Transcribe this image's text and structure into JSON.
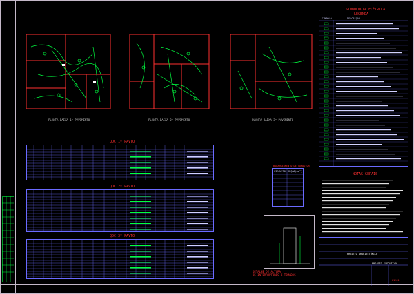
{
  "drawing": {
    "plans": [
      {
        "caption": "PLANTA BAIXA 1º PAVIMENTO"
      },
      {
        "caption": "PLANTA BAIXA 2º PAVIMENTO"
      },
      {
        "caption": "PLANTA BAIXA 3º PAVIMENTO"
      }
    ],
    "legend": {
      "title": "SIMBOLOGIA ELÉTRICA",
      "subtitle": "LEGENDA",
      "col1": "SÍMBOLO",
      "col2": "DESCRIÇÃO"
    },
    "tables": [
      {
        "title": "QDC 1º PAVTO"
      },
      {
        "title": "QDC 2º PAVTO"
      },
      {
        "title": "QDC 3º PAVTO"
      }
    ],
    "conductor_table": {
      "title": "BALANCEAMENTO DE CONDUTOR",
      "col1": "CIRCUITO",
      "col2": "SEÇÃO(mm²)"
    },
    "notes": {
      "title": "NOTAS GERAIS"
    },
    "detail_caption": "DETALHE DE ALTURA\nDE INTERRUPTORES E TOMADAS",
    "title_block": {
      "project": "PROJETO ARQUITETÔNICO",
      "phase": "PROJETO EXECUTIVO",
      "sheet": "01/01"
    },
    "colors": {
      "frame": "#c4b8c8",
      "plan_wall": "#ff3030",
      "circuit": "#00ff40",
      "table_line": "#6a6aff",
      "title_red": "#ff3030"
    }
  }
}
